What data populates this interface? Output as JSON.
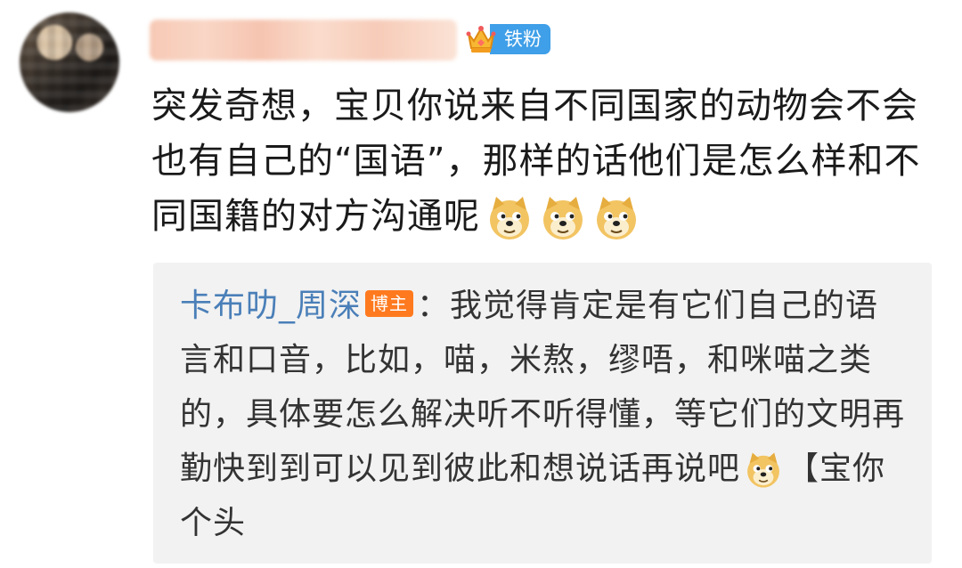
{
  "header": {
    "fan_badge_label": "铁粉"
  },
  "comment": {
    "text": "突发奇想，宝贝你说来自不同国家的动物会不会也有自己的“国语”，那样的话他们是怎么样和不同国籍的对方沟通呢",
    "emojis": [
      "doge-emoji",
      "doge-emoji",
      "doge-emoji"
    ]
  },
  "reply": {
    "author": "卡布叻_周深",
    "author_badge": "博主",
    "separator": "：",
    "text": "我觉得肯定是有它们自己的语言和口音，比如，喵，米熬，缪唔，和咪喵之类的，具体要怎么解决听不听得懂，等它们的文明再勤快到到可以见到彼此和想说话再说吧",
    "tail": "【宝你个头"
  },
  "colors": {
    "fan_badge": "#3f9fe8",
    "author_link": "#4a7fb8",
    "author_badge": "#ff7a1f",
    "reply_bg": "#f2f2f2"
  }
}
